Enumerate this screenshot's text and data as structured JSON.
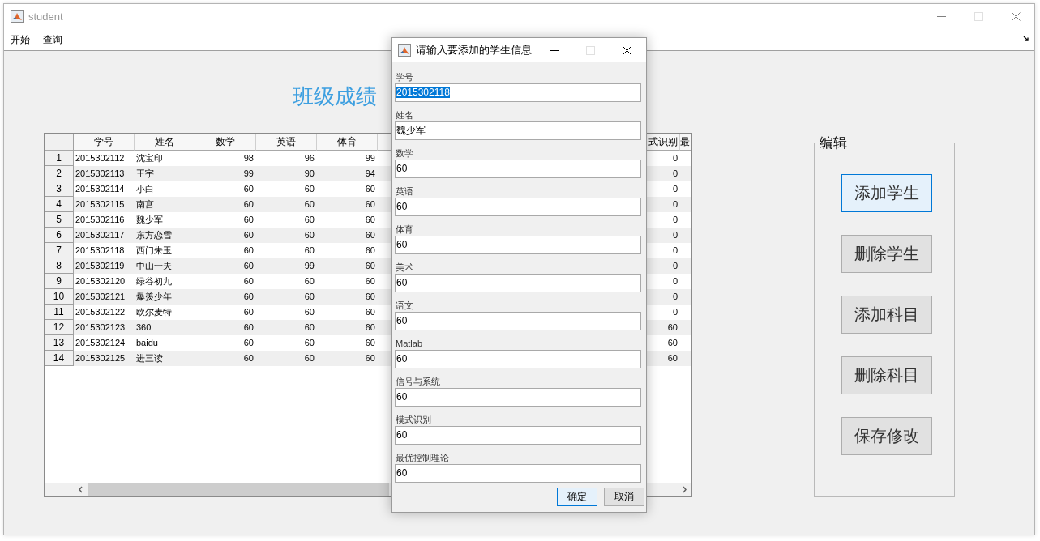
{
  "main_window": {
    "title": "student",
    "active": false,
    "controls": [
      {
        "kind": "minimize",
        "disabled": false
      },
      {
        "kind": "maximize",
        "disabled": true
      },
      {
        "kind": "close",
        "disabled": false
      }
    ],
    "menu": [
      {
        "label": "开始"
      },
      {
        "label": "查询"
      }
    ],
    "heading": "班级成绩",
    "table": {
      "columns": [
        {
          "label": "学号",
          "kind": "text"
        },
        {
          "label": "姓名",
          "kind": "text"
        },
        {
          "label": "数学",
          "kind": "number"
        },
        {
          "label": "英语",
          "kind": "number"
        },
        {
          "label": "体育",
          "kind": "number"
        },
        {
          "label": "式识别",
          "kind": "number"
        },
        {
          "label": "最",
          "kind": "number"
        }
      ],
      "rows": [
        {
          "number": "1",
          "cells": [
            "2015302112",
            "沈宝印",
            "98",
            "96",
            "99",
            "0"
          ]
        },
        {
          "number": "2",
          "cells": [
            "2015302113",
            "王宇",
            "99",
            "90",
            "94",
            "0"
          ]
        },
        {
          "number": "3",
          "cells": [
            "2015302114",
            "小白",
            "60",
            "60",
            "60",
            "0"
          ]
        },
        {
          "number": "4",
          "cells": [
            "2015302115",
            "南宫",
            "60",
            "60",
            "60",
            "0"
          ]
        },
        {
          "number": "5",
          "cells": [
            "2015302116",
            "魏少军",
            "60",
            "60",
            "60",
            "0"
          ]
        },
        {
          "number": "6",
          "cells": [
            "2015302117",
            "东方恋雪",
            "60",
            "60",
            "60",
            "0"
          ]
        },
        {
          "number": "7",
          "cells": [
            "2015302118",
            "西门朱玉",
            "60",
            "60",
            "60",
            "0"
          ]
        },
        {
          "number": "8",
          "cells": [
            "2015302119",
            "中山一夫",
            "60",
            "99",
            "60",
            "0"
          ]
        },
        {
          "number": "9",
          "cells": [
            "2015302120",
            "绿谷初九",
            "60",
            "60",
            "60",
            "0"
          ]
        },
        {
          "number": "10",
          "cells": [
            "2015302121",
            "爆羡少年",
            "60",
            "60",
            "60",
            "0"
          ]
        },
        {
          "number": "11",
          "cells": [
            "2015302122",
            "欧尔麦特",
            "60",
            "60",
            "60",
            "0"
          ]
        },
        {
          "number": "12",
          "cells": [
            "2015302123",
            "360",
            "60",
            "60",
            "60",
            "60"
          ]
        },
        {
          "number": "13",
          "cells": [
            "2015302124",
            "baidu",
            "60",
            "60",
            "60",
            "60"
          ]
        },
        {
          "number": "14",
          "cells": [
            "2015302125",
            "进三读",
            "60",
            "60",
            "60",
            "60"
          ]
        }
      ]
    },
    "edit_panel": {
      "title": "编辑",
      "buttons": [
        {
          "label": "添加学生",
          "focused": true
        },
        {
          "label": "删除学生",
          "focused": false
        },
        {
          "label": "添加科目",
          "focused": false
        },
        {
          "label": "删除科目",
          "focused": false
        },
        {
          "label": "保存修改",
          "focused": false
        }
      ]
    }
  },
  "dialog": {
    "title": "请输入要添加的学生信息",
    "active": true,
    "controls": [
      {
        "kind": "minimize",
        "disabled": false
      },
      {
        "kind": "maximize",
        "disabled": true
      },
      {
        "kind": "close",
        "disabled": false
      }
    ],
    "fields": [
      {
        "label": "学号",
        "value": "2015302118",
        "text_selected": true
      },
      {
        "label": "姓名",
        "value": "魏少军",
        "text_selected": false
      },
      {
        "label": "数学",
        "value": "60",
        "text_selected": false
      },
      {
        "label": "英语",
        "value": "60",
        "text_selected": false
      },
      {
        "label": "体育",
        "value": "60",
        "text_selected": false
      },
      {
        "label": "美术",
        "value": "60",
        "text_selected": false
      },
      {
        "label": "语文",
        "value": "60",
        "text_selected": false
      },
      {
        "label": "Matlab",
        "value": "60",
        "text_selected": false
      },
      {
        "label": "信号与系统",
        "value": "60",
        "text_selected": false
      },
      {
        "label": "模式识别",
        "value": "60",
        "text_selected": false
      },
      {
        "label": "最优控制理论",
        "value": "60",
        "text_selected": false
      }
    ],
    "buttons": [
      {
        "label": "确定",
        "focused": true
      },
      {
        "label": "取消",
        "focused": false
      }
    ]
  }
}
